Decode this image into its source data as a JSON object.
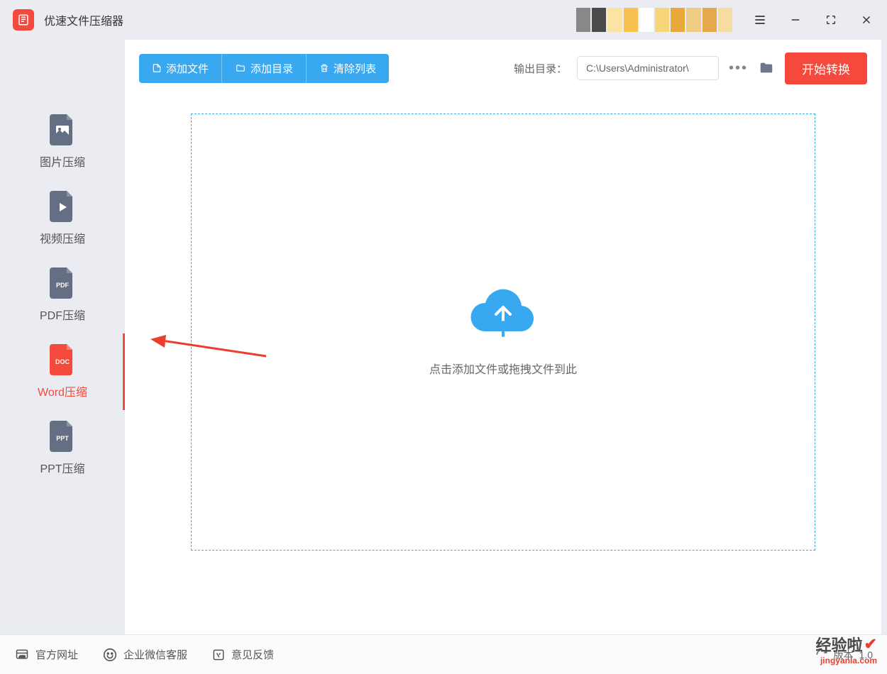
{
  "app": {
    "title": "优速文件压缩器"
  },
  "sidebar": {
    "items": [
      {
        "label": "图片压缩",
        "badge": ""
      },
      {
        "label": "视频压缩",
        "badge": ""
      },
      {
        "label": "PDF压缩",
        "badge": "PDF"
      },
      {
        "label": "Word压缩",
        "badge": "DOC"
      },
      {
        "label": "PPT压缩",
        "badge": "PPT"
      }
    ],
    "active_index": 3
  },
  "toolbar": {
    "add_file": "添加文件",
    "add_folder": "添加目录",
    "clear_list": "清除列表",
    "output_label": "输出目录：",
    "output_path": "C:\\Users\\Administrator\\",
    "start_button": "开始转换"
  },
  "dropzone": {
    "hint": "点击添加文件或拖拽文件到此"
  },
  "footer": {
    "official_site": "官方网址",
    "wechat_support": "企业微信客服",
    "feedback": "意见反馈",
    "version_label": "版本",
    "version_value": "1.0"
  },
  "watermark": {
    "line1": "经验啦",
    "line2": "jingyanla.com"
  },
  "colors": {
    "accent_red": "#f4493c",
    "accent_blue": "#38a9f0",
    "icon_gray": "#656f84"
  }
}
